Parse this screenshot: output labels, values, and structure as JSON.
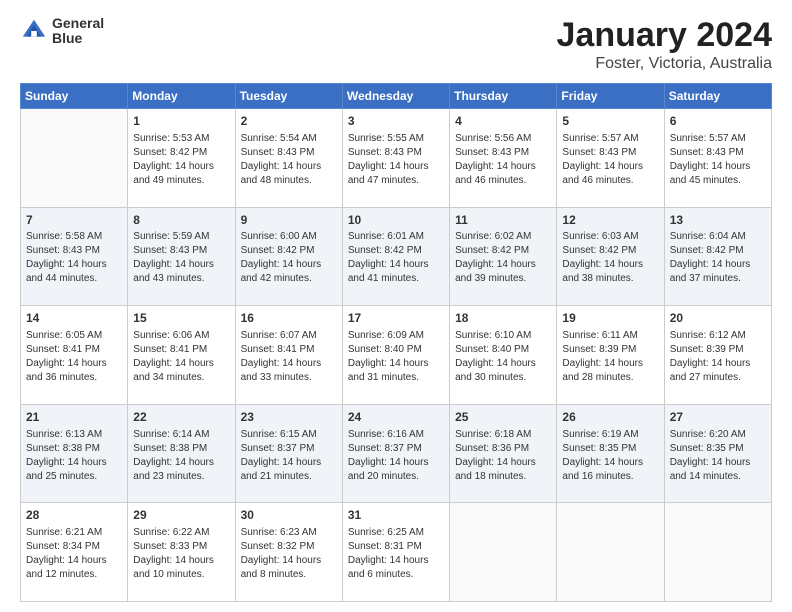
{
  "logo": {
    "line1": "General",
    "line2": "Blue"
  },
  "title": "January 2024",
  "subtitle": "Foster, Victoria, Australia",
  "header_days": [
    "Sunday",
    "Monday",
    "Tuesday",
    "Wednesday",
    "Thursday",
    "Friday",
    "Saturday"
  ],
  "weeks": [
    [
      {
        "day": "",
        "info": ""
      },
      {
        "day": "1",
        "info": "Sunrise: 5:53 AM\nSunset: 8:42 PM\nDaylight: 14 hours\nand 49 minutes."
      },
      {
        "day": "2",
        "info": "Sunrise: 5:54 AM\nSunset: 8:43 PM\nDaylight: 14 hours\nand 48 minutes."
      },
      {
        "day": "3",
        "info": "Sunrise: 5:55 AM\nSunset: 8:43 PM\nDaylight: 14 hours\nand 47 minutes."
      },
      {
        "day": "4",
        "info": "Sunrise: 5:56 AM\nSunset: 8:43 PM\nDaylight: 14 hours\nand 46 minutes."
      },
      {
        "day": "5",
        "info": "Sunrise: 5:57 AM\nSunset: 8:43 PM\nDaylight: 14 hours\nand 46 minutes."
      },
      {
        "day": "6",
        "info": "Sunrise: 5:57 AM\nSunset: 8:43 PM\nDaylight: 14 hours\nand 45 minutes."
      }
    ],
    [
      {
        "day": "7",
        "info": "Sunrise: 5:58 AM\nSunset: 8:43 PM\nDaylight: 14 hours\nand 44 minutes."
      },
      {
        "day": "8",
        "info": "Sunrise: 5:59 AM\nSunset: 8:43 PM\nDaylight: 14 hours\nand 43 minutes."
      },
      {
        "day": "9",
        "info": "Sunrise: 6:00 AM\nSunset: 8:42 PM\nDaylight: 14 hours\nand 42 minutes."
      },
      {
        "day": "10",
        "info": "Sunrise: 6:01 AM\nSunset: 8:42 PM\nDaylight: 14 hours\nand 41 minutes."
      },
      {
        "day": "11",
        "info": "Sunrise: 6:02 AM\nSunset: 8:42 PM\nDaylight: 14 hours\nand 39 minutes."
      },
      {
        "day": "12",
        "info": "Sunrise: 6:03 AM\nSunset: 8:42 PM\nDaylight: 14 hours\nand 38 minutes."
      },
      {
        "day": "13",
        "info": "Sunrise: 6:04 AM\nSunset: 8:42 PM\nDaylight: 14 hours\nand 37 minutes."
      }
    ],
    [
      {
        "day": "14",
        "info": "Sunrise: 6:05 AM\nSunset: 8:41 PM\nDaylight: 14 hours\nand 36 minutes."
      },
      {
        "day": "15",
        "info": "Sunrise: 6:06 AM\nSunset: 8:41 PM\nDaylight: 14 hours\nand 34 minutes."
      },
      {
        "day": "16",
        "info": "Sunrise: 6:07 AM\nSunset: 8:41 PM\nDaylight: 14 hours\nand 33 minutes."
      },
      {
        "day": "17",
        "info": "Sunrise: 6:09 AM\nSunset: 8:40 PM\nDaylight: 14 hours\nand 31 minutes."
      },
      {
        "day": "18",
        "info": "Sunrise: 6:10 AM\nSunset: 8:40 PM\nDaylight: 14 hours\nand 30 minutes."
      },
      {
        "day": "19",
        "info": "Sunrise: 6:11 AM\nSunset: 8:39 PM\nDaylight: 14 hours\nand 28 minutes."
      },
      {
        "day": "20",
        "info": "Sunrise: 6:12 AM\nSunset: 8:39 PM\nDaylight: 14 hours\nand 27 minutes."
      }
    ],
    [
      {
        "day": "21",
        "info": "Sunrise: 6:13 AM\nSunset: 8:38 PM\nDaylight: 14 hours\nand 25 minutes."
      },
      {
        "day": "22",
        "info": "Sunrise: 6:14 AM\nSunset: 8:38 PM\nDaylight: 14 hours\nand 23 minutes."
      },
      {
        "day": "23",
        "info": "Sunrise: 6:15 AM\nSunset: 8:37 PM\nDaylight: 14 hours\nand 21 minutes."
      },
      {
        "day": "24",
        "info": "Sunrise: 6:16 AM\nSunset: 8:37 PM\nDaylight: 14 hours\nand 20 minutes."
      },
      {
        "day": "25",
        "info": "Sunrise: 6:18 AM\nSunset: 8:36 PM\nDaylight: 14 hours\nand 18 minutes."
      },
      {
        "day": "26",
        "info": "Sunrise: 6:19 AM\nSunset: 8:35 PM\nDaylight: 14 hours\nand 16 minutes."
      },
      {
        "day": "27",
        "info": "Sunrise: 6:20 AM\nSunset: 8:35 PM\nDaylight: 14 hours\nand 14 minutes."
      }
    ],
    [
      {
        "day": "28",
        "info": "Sunrise: 6:21 AM\nSunset: 8:34 PM\nDaylight: 14 hours\nand 12 minutes."
      },
      {
        "day": "29",
        "info": "Sunrise: 6:22 AM\nSunset: 8:33 PM\nDaylight: 14 hours\nand 10 minutes."
      },
      {
        "day": "30",
        "info": "Sunrise: 6:23 AM\nSunset: 8:32 PM\nDaylight: 14 hours\nand 8 minutes."
      },
      {
        "day": "31",
        "info": "Sunrise: 6:25 AM\nSunset: 8:31 PM\nDaylight: 14 hours\nand 6 minutes."
      },
      {
        "day": "",
        "info": ""
      },
      {
        "day": "",
        "info": ""
      },
      {
        "day": "",
        "info": ""
      }
    ]
  ]
}
